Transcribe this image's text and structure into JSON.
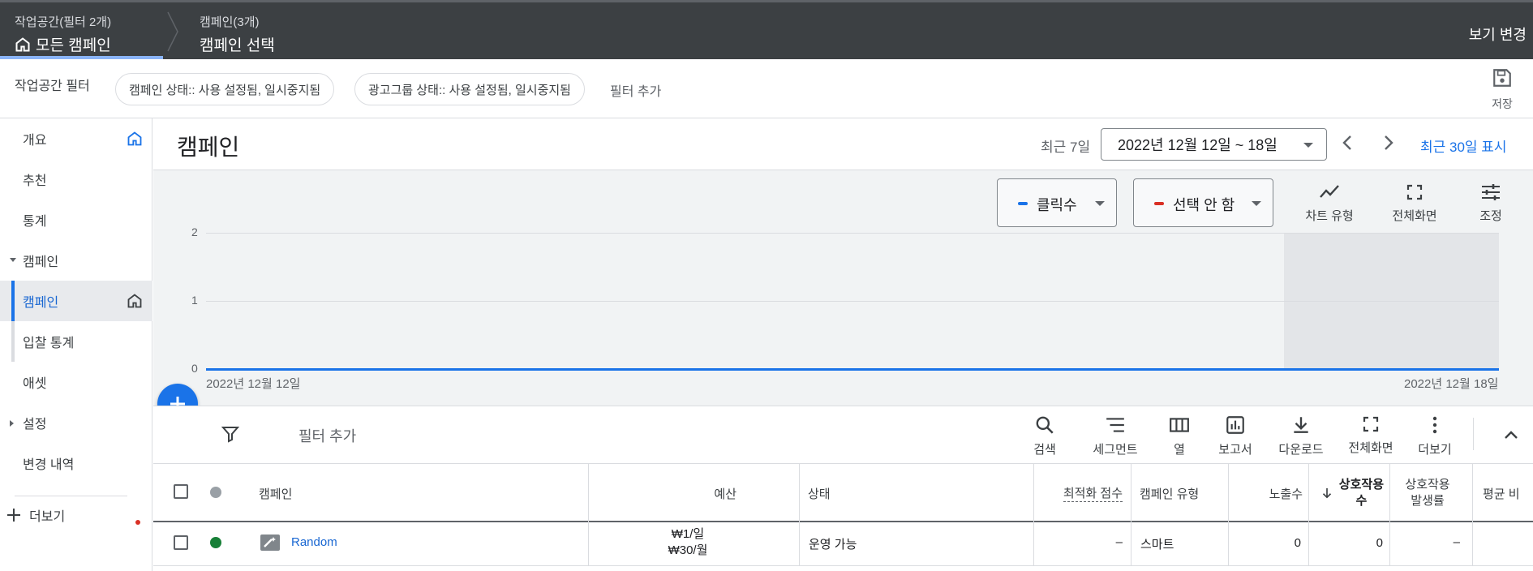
{
  "topbar": {
    "workspace_sub": "작업공간(필터 2개)",
    "workspace_main": "모든 캠페인",
    "campaign_sub": "캠페인(3개)",
    "campaign_main": "캠페인 선택",
    "view_change": "보기 변경"
  },
  "filterbar": {
    "label": "작업공간 필터",
    "chips": [
      "캠페인 상태:: 사용 설정됨, 일시중지됨",
      "광고그룹 상태:: 사용 설정됨, 일시중지됨"
    ],
    "add_filter": "필터 추가",
    "save": "저장"
  },
  "sidebar": {
    "items": [
      {
        "label": "개요"
      },
      {
        "label": "추천"
      },
      {
        "label": "통계"
      },
      {
        "label": "캠페인"
      },
      {
        "label": "캠페인"
      },
      {
        "label": "입찰 통계"
      },
      {
        "label": "애셋"
      },
      {
        "label": "설정"
      },
      {
        "label": "변경 내역"
      }
    ],
    "more": "더보기"
  },
  "header": {
    "title": "캠페인",
    "recent_label": "최근 7일",
    "date_range": "2022년 12월 12일 ~ 18일",
    "show_30": "최근 30일 표시"
  },
  "chart_controls": {
    "metric1": "클릭수",
    "metric1_color": "#1a73e8",
    "metric2": "선택 안 함",
    "metric2_color": "#d93025",
    "tools": [
      "차트 유형",
      "전체화면",
      "조정"
    ]
  },
  "chart_data": {
    "type": "line",
    "x": [
      "2022년 12월 12일",
      "2022년 12월 18일"
    ],
    "series": [
      {
        "name": "클릭수",
        "values": [
          0,
          0
        ]
      }
    ],
    "yticks": [
      "2",
      "1",
      "0"
    ],
    "ylim": [
      0,
      2
    ],
    "xlabel_start": "2022년 12월 12일",
    "xlabel_end": "2022년 12월 18일",
    "grid": true
  },
  "table_toolbar": {
    "add_filter": "필터 추가",
    "tools": [
      "검색",
      "세그먼트",
      "열",
      "보고서",
      "다운로드",
      "전체화면",
      "더보기"
    ]
  },
  "table": {
    "columns": {
      "campaign": "캠페인",
      "budget": "예산",
      "status": "상태",
      "opt_score": "최적화 점수",
      "campaign_type": "캠페인 유형",
      "impressions": "노출수",
      "interactions_1": "상호작용",
      "interactions_2": "수",
      "interaction_rate_1": "상호작용",
      "interaction_rate_2": "발생률",
      "avg": "평균 비"
    },
    "rows": [
      {
        "name": "Random",
        "budget_daily": "₩1/일",
        "budget_monthly": "₩30/월",
        "status": "운영 가능",
        "opt_score": "–",
        "type": "스마트",
        "impressions": "0",
        "interactions": "0",
        "interaction_rate": "–"
      }
    ]
  }
}
